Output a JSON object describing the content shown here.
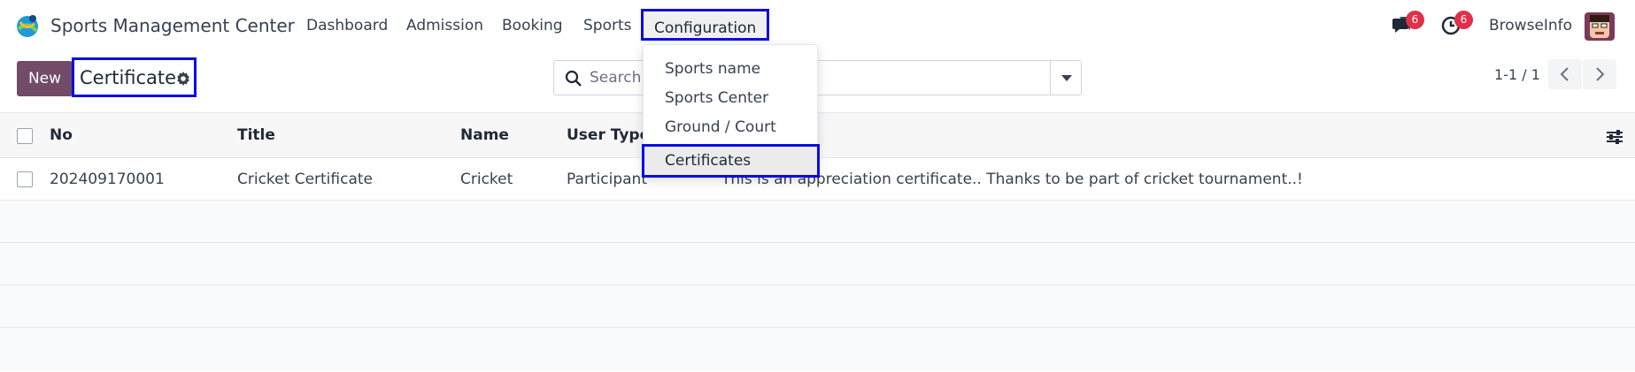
{
  "app": {
    "name": "Sports Management Center"
  },
  "nav": {
    "menu": [
      {
        "label": "Dashboard"
      },
      {
        "label": "Admission"
      },
      {
        "label": "Booking"
      },
      {
        "label": "Sports"
      },
      {
        "label": "Configuration"
      }
    ],
    "messages_count": "6",
    "activities_count": "6",
    "user_name": "BrowseInfo"
  },
  "control_panel": {
    "new_button": "New",
    "breadcrumb_title": "Certificate",
    "search_placeholder": "Search...",
    "pager_value": "1-1 / 1"
  },
  "list": {
    "columns": [
      "No",
      "Title",
      "Name",
      "User Type"
    ],
    "rows": [
      {
        "no": "202409170001",
        "title": "Cricket Certificate",
        "name": "Cricket",
        "user_type": "Participant",
        "description": "This is an appreciation certificate.. Thanks to be part of cricket tournament..!"
      }
    ]
  },
  "dropdown": {
    "items": [
      {
        "label": "Sports name"
      },
      {
        "label": "Sports Center"
      },
      {
        "label": "Ground / Court"
      },
      {
        "label": "Certificates"
      }
    ]
  },
  "colors": {
    "brand": "#714b67",
    "highlight_box": "#0a0ae6",
    "badge": "#e0304a"
  },
  "icons": [
    "app-logo-icon",
    "chat-icon",
    "clock-icon",
    "gear-icon",
    "search-icon",
    "chevron-left-icon",
    "chevron-right-icon",
    "sliders-icon"
  ]
}
